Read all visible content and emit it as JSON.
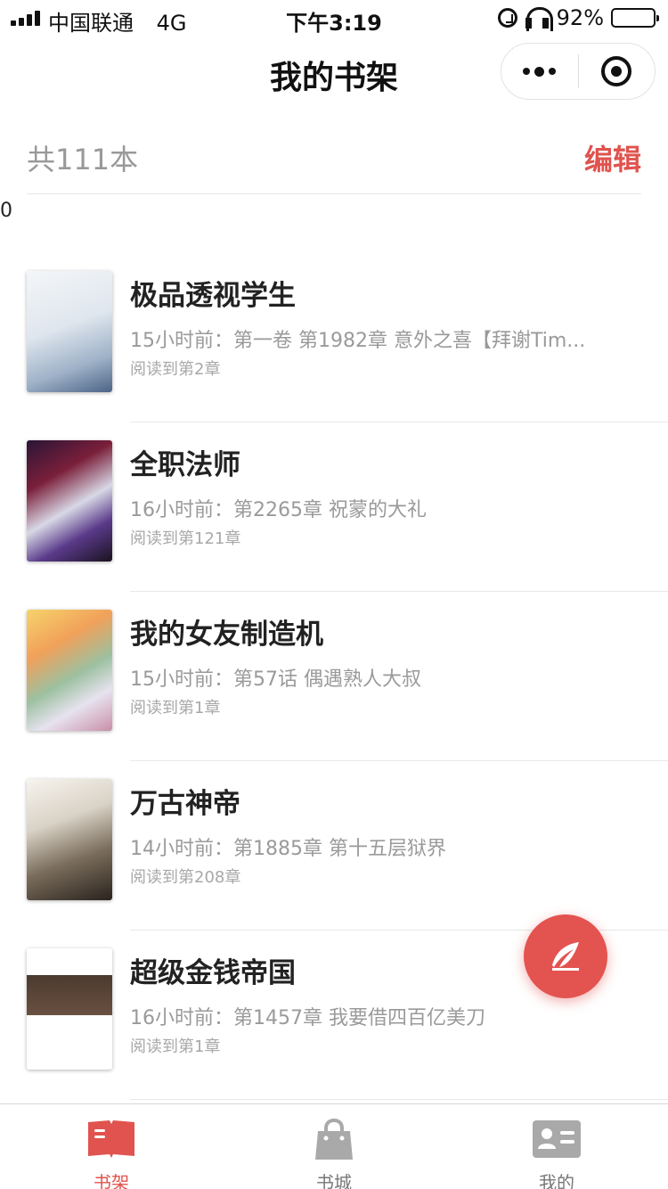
{
  "status_bar": {
    "carrier": "中国联通",
    "network": "4G",
    "time": "下午3:19",
    "battery_text": "92%",
    "battery_level": 0.92
  },
  "nav": {
    "title": "我的书架"
  },
  "shelf": {
    "count_label": "共111本",
    "edit_label": "编辑",
    "stray_text": "0"
  },
  "books": [
    {
      "title": "极品透视学生",
      "update": "15小时前：第一卷 第1982章 意外之喜【拜谢Tim...",
      "progress": "阅读到第2章",
      "cover_icon": "book-cover-image"
    },
    {
      "title": "全职法师",
      "update": "16小时前：第2265章 祝蒙的大礼",
      "progress": "阅读到第121章",
      "cover_icon": "book-cover-image"
    },
    {
      "title": "我的女友制造机",
      "update": "15小时前：第57话 偶遇熟人大叔",
      "progress": "阅读到第1章",
      "cover_icon": "book-cover-image"
    },
    {
      "title": "万古神帝",
      "update": "14小时前：第1885章 第十五层狱界",
      "progress": "阅读到第208章",
      "cover_icon": "book-cover-image"
    },
    {
      "title": "超级金钱帝国",
      "update": "16小时前：第1457章 我要借四百亿美刀",
      "progress": "阅读到第1章",
      "cover_icon": "book-cover-image"
    }
  ],
  "fab": {
    "icon": "feather-quill-icon"
  },
  "tabs": [
    {
      "label": "书架",
      "icon": "open-book-icon",
      "active": true
    },
    {
      "label": "书城",
      "icon": "shopping-bag-icon",
      "active": false
    },
    {
      "label": "我的",
      "icon": "id-card-icon",
      "active": false
    }
  ],
  "colors": {
    "accent": "#e0534e",
    "fab": "#e35350",
    "inactive_tab": "#a9a9a9",
    "muted_text": "#9a9a9a"
  }
}
